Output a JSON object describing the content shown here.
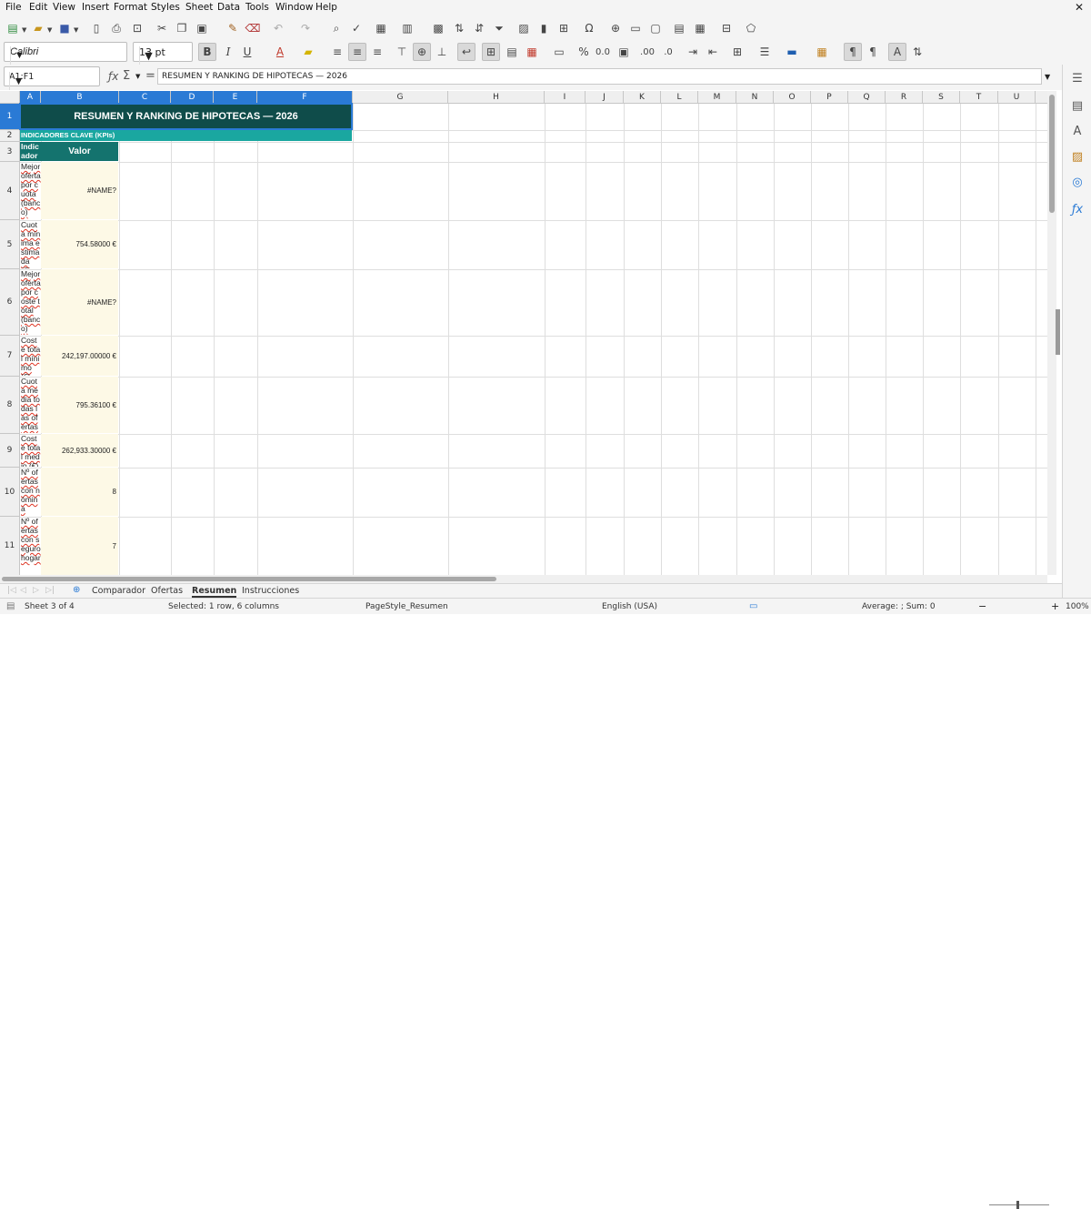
{
  "menu": [
    "File",
    "Edit",
    "View",
    "Insert",
    "Format",
    "Styles",
    "Sheet",
    "Data",
    "Tools",
    "Window",
    "Help"
  ],
  "font_name": "Calibri",
  "font_size": "13 pt",
  "name_box": "A1:F1",
  "formula_text": "RESUMEN Y RANKING DE HIPOTECAS — 2026",
  "columns": [
    "A",
    "B",
    "C",
    "D",
    "E",
    "F",
    "G",
    "H",
    "I",
    "J",
    "K",
    "L",
    "M",
    "N",
    "O",
    "P",
    "Q",
    "R",
    "S",
    "T",
    "U"
  ],
  "rows": [
    "1",
    "2",
    "3",
    "4",
    "5",
    "6",
    "7",
    "8",
    "9",
    "10",
    "11"
  ],
  "sheet": {
    "title": "RESUMEN Y RANKING DE HIPOTECAS — 2026",
    "section": "INDICADORES CLAVE (KPIs)",
    "header_indicador": "Indicador",
    "header_valor": "Valor",
    "kpis": [
      {
        "label": "Mejor oferta por cuota (banco)",
        "value": "#NAME?"
      },
      {
        "label": "Cuota mínima estimada (€)",
        "value": "754.58000 €"
      },
      {
        "label": "Mejor oferta por coste total (banco)",
        "value": "#NAME?"
      },
      {
        "label": "Coste total mínimo (€)",
        "value": "242,197.00000 €"
      },
      {
        "label": "Cuota media todas las ofertas (€)",
        "value": "795.36100 €"
      },
      {
        "label": "Coste total medio (€)",
        "value": "262,933.30000 €"
      },
      {
        "label": "Nº ofertas con nómina",
        "value": "8"
      },
      {
        "label": "Nº ofertas con seguro hogar",
        "value": "7"
      }
    ]
  },
  "tabs": [
    "Comparador",
    "Ofertas",
    "Resumen",
    "Instrucciones"
  ],
  "active_tab": "Resumen",
  "status": {
    "sheet": "Sheet 3 of 4",
    "selection": "Selected: 1 row, 6 columns",
    "page_style": "PageStyle_Resumen",
    "language": "English (USA)",
    "sum": "Average: ; Sum: 0",
    "zoom": "100%"
  },
  "colors": {
    "title_bg": "#0f4c4a",
    "section_bg": "#1aa7a0",
    "header_bg": "#14736e",
    "value_bg": "#fdf9e6",
    "selection": "#2a7ad5"
  }
}
